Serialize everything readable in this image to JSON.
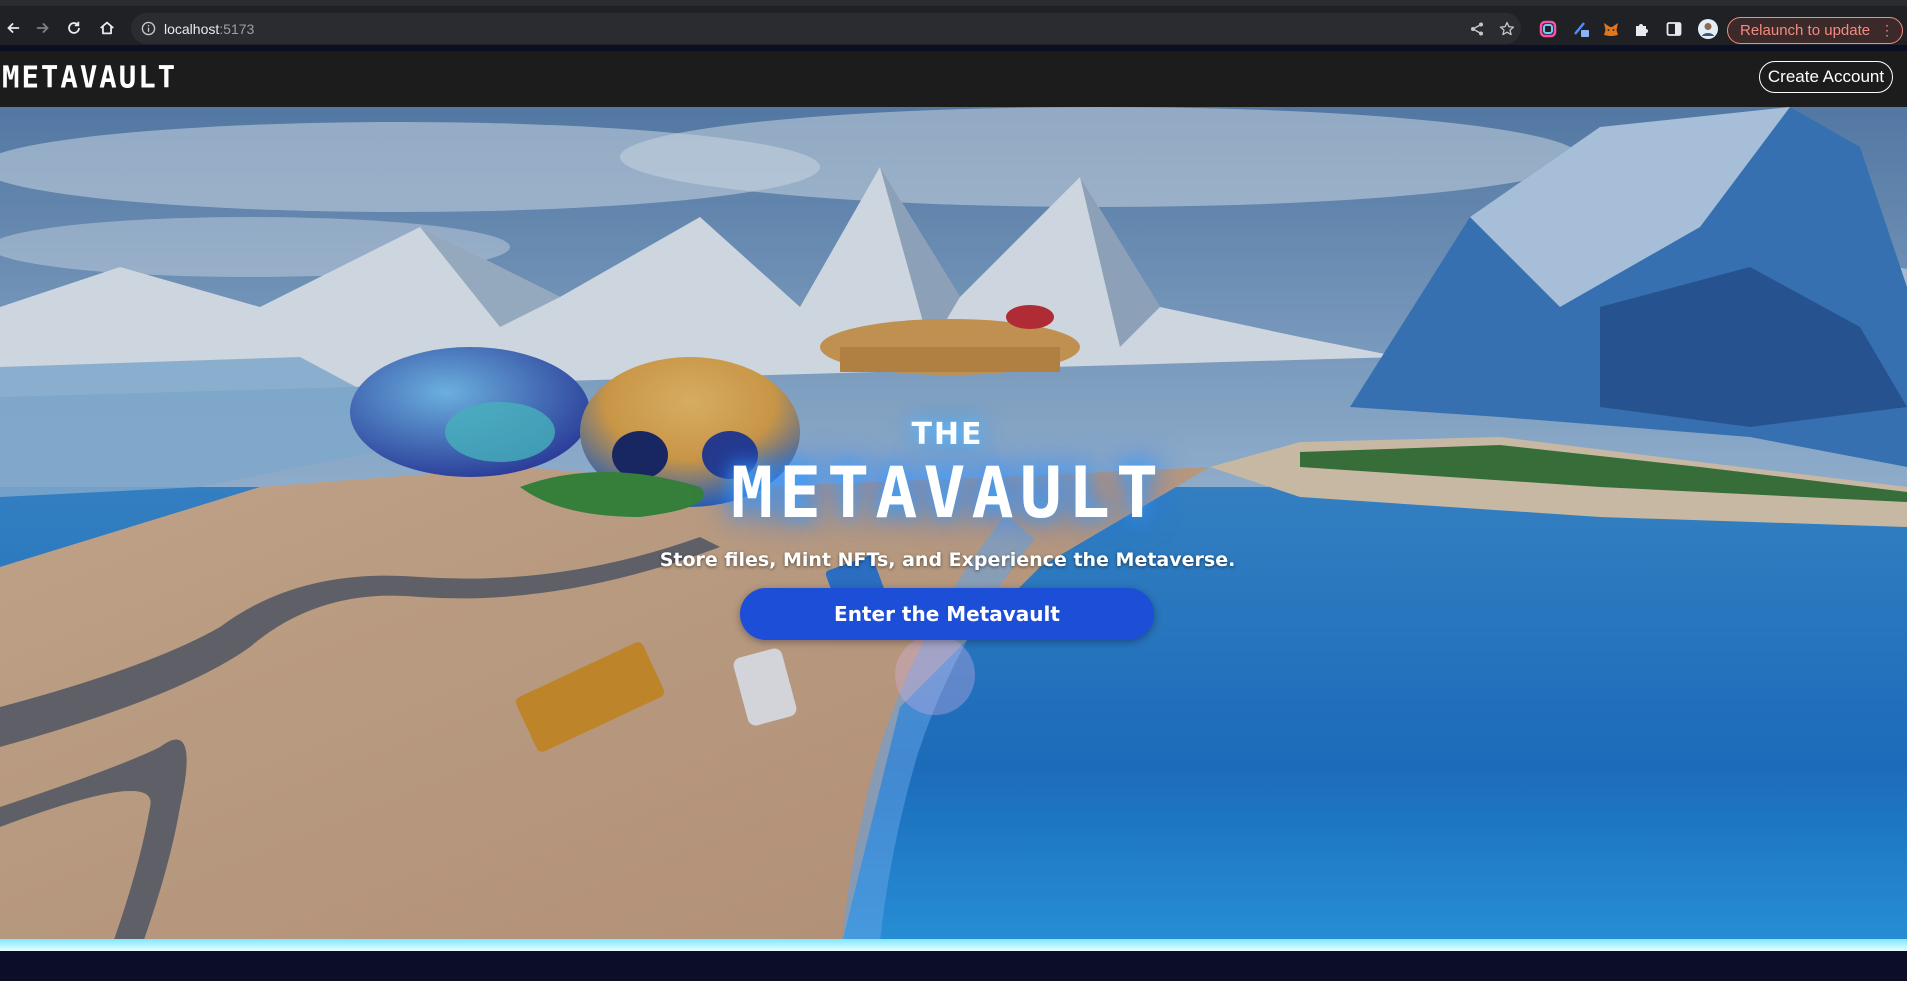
{
  "browser": {
    "url_host": "localhost",
    "url_port": ":5173",
    "relaunch_label": "Relaunch to update",
    "menu_glyph": "⋮"
  },
  "header": {
    "logo": "METAVAULT",
    "create_account_label": "Create Account"
  },
  "hero": {
    "pre_title": "THE",
    "title": "METAVAULT",
    "subtitle": "Store files, Mint NFTs, and Experience the Metaverse.",
    "cta_label": "Enter the Metavault"
  },
  "colors": {
    "cta": "#1d4ed8",
    "header_bg": "#1c1c1c",
    "relaunch": "#f28b82",
    "glow": "#39a7ff"
  }
}
